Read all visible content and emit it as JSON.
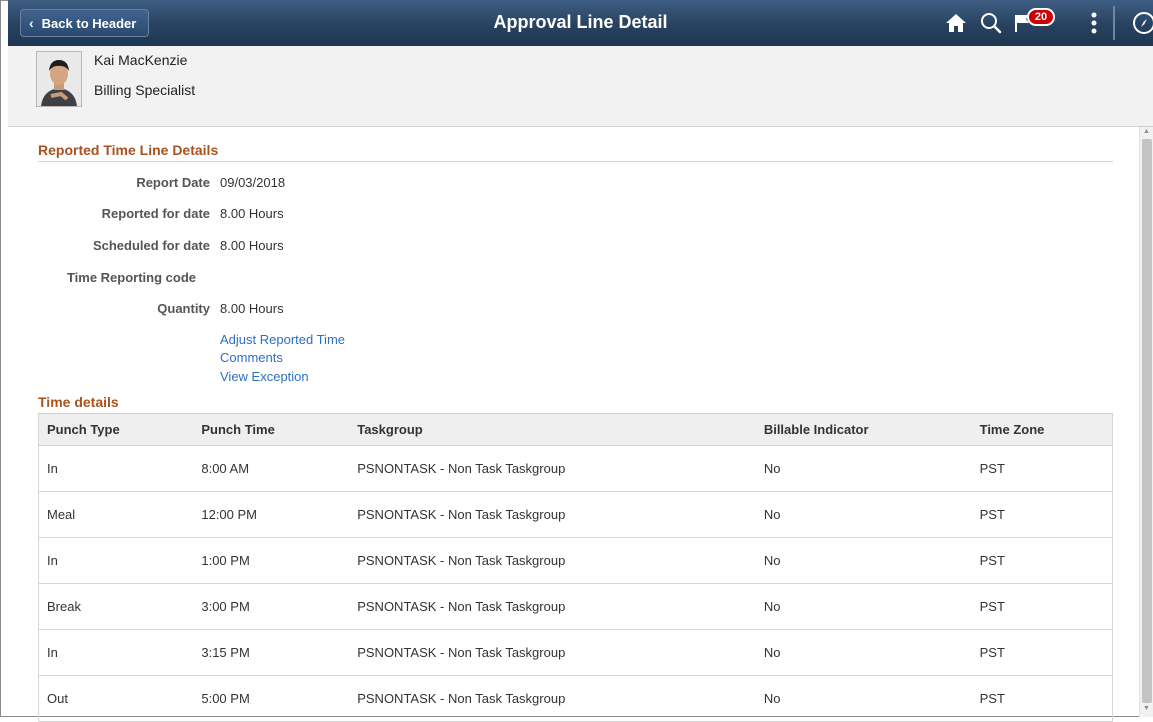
{
  "header": {
    "back_label": "Back to Header",
    "title": "Approval Line Detail",
    "notification_count": "20",
    "bg_color": "#2b4869"
  },
  "employee": {
    "name": "Kai MacKenzie",
    "job_title": "Billing Specialist"
  },
  "reported_time": {
    "section_title": "Reported Time Line Details",
    "fields": [
      {
        "label": "Report Date",
        "value": "09/03/2018"
      },
      {
        "label": "Reported for date",
        "value": "8.00 Hours"
      },
      {
        "label": "Scheduled for date",
        "value": "8.00 Hours"
      },
      {
        "label": "Time Reporting code",
        "value": ""
      },
      {
        "label": "Quantity",
        "value": "8.00 Hours"
      }
    ],
    "links": [
      "Adjust Reported Time",
      "Comments",
      "View Exception"
    ]
  },
  "time_details": {
    "section_title": "Time details",
    "columns": [
      "Punch Type",
      "Punch Time",
      "Taskgroup",
      "Billable Indicator",
      "Time Zone"
    ],
    "rows": [
      [
        "In",
        "8:00 AM",
        "PSNONTASK - Non Task Taskgroup",
        "No",
        "PST"
      ],
      [
        "Meal",
        "12:00 PM",
        "PSNONTASK - Non Task Taskgroup",
        "No",
        "PST"
      ],
      [
        "In",
        "1:00 PM",
        "PSNONTASK - Non Task Taskgroup",
        "No",
        "PST"
      ],
      [
        "Break",
        "3:00 PM",
        "PSNONTASK - Non Task Taskgroup",
        "No",
        "PST"
      ],
      [
        "In",
        "3:15 PM",
        "PSNONTASK - Non Task Taskgroup",
        "No",
        "PST"
      ],
      [
        "Out",
        "5:00 PM",
        "PSNONTASK - Non Task Taskgroup",
        "No",
        "PST"
      ]
    ]
  },
  "colors": {
    "section_title": "#a9521f",
    "link": "#2d6fc4"
  },
  "icons": {
    "home": "home-icon",
    "search": "search-icon",
    "notifications": "flag-icon",
    "actions": "more-vertical-icon",
    "navbar": "compass-icon"
  }
}
